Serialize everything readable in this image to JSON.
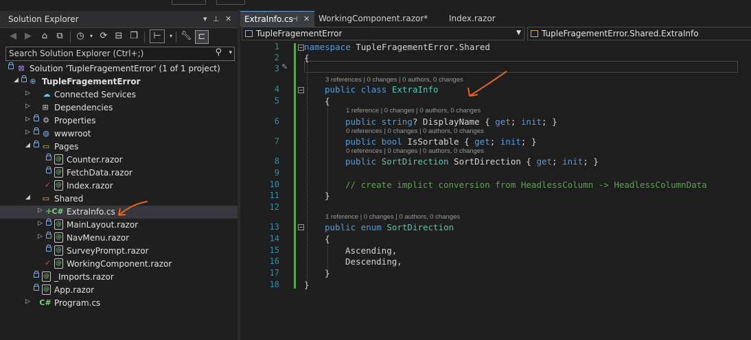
{
  "solution_explorer": {
    "title": "Solution Explorer",
    "search_placeholder": "Search Solution Explorer (Ctrl+;)",
    "tree": [
      {
        "label": "Solution 'TupleFragementError' (1 of 1 project)",
        "icon": "solution-icon"
      },
      {
        "label": "TupleFragementError",
        "icon": "project-icon"
      },
      {
        "label": "Connected Services",
        "icon": "connected-services-icon"
      },
      {
        "label": "Dependencies",
        "icon": "dependencies-icon"
      },
      {
        "label": "Properties",
        "icon": "properties-icon"
      },
      {
        "label": "wwwroot",
        "icon": "globe-icon"
      },
      {
        "label": "Pages",
        "icon": "folder-icon"
      },
      {
        "label": "Counter.razor",
        "icon": "razor-file-icon"
      },
      {
        "label": "FetchData.razor",
        "icon": "razor-file-icon"
      },
      {
        "label": "Index.razor",
        "icon": "razor-file-icon"
      },
      {
        "label": "Shared",
        "icon": "folder-icon"
      },
      {
        "label": "ExtraInfo.cs",
        "icon": "csharp-file-icon"
      },
      {
        "label": "MainLayout.razor",
        "icon": "razor-file-icon"
      },
      {
        "label": "NavMenu.razor",
        "icon": "razor-file-icon"
      },
      {
        "label": "SurveyPrompt.razor",
        "icon": "razor-file-icon"
      },
      {
        "label": "WorkingComponent.razor",
        "icon": "razor-file-icon"
      },
      {
        "label": "_Imports.razor",
        "icon": "razor-file-icon"
      },
      {
        "label": "App.razor",
        "icon": "razor-file-icon"
      },
      {
        "label": "Program.cs",
        "icon": "csharp-file-icon"
      }
    ]
  },
  "editor": {
    "tabs": [
      {
        "label": "ExtraInfo.cs",
        "active": true
      },
      {
        "label": "WorkingComponent.razor*",
        "active": false
      },
      {
        "label": "Index.razor",
        "active": false
      }
    ],
    "nav_project": "TupleFragementError",
    "nav_member": "TupleFragementError.Shared.ExtraInfo",
    "line_numbers": [
      "1",
      "2",
      "3",
      "4",
      "5",
      "6",
      "7",
      "8",
      "9",
      "10",
      "11",
      "12",
      "13",
      "14",
      "15",
      "16",
      "17",
      "18"
    ],
    "code": {
      "l1_kw": "namespace",
      "l1_rest": " TupleFragementError.Shared",
      "l2": "{",
      "lens_class": "3 references | 0 changes | 0 authors, 0 changes",
      "l4_kw": "public class",
      "l4_type": "ExtraInfo",
      "l5": "{",
      "lens_p1": "1 reference | 0 changes | 0 authors, 0 changes",
      "l6_kw1": "public string",
      "l6_mid": "? DisplayName { ",
      "l6_kw2": "get",
      "l6_mid2": "; ",
      "l6_kw3": "init",
      "l6_end": "; }",
      "lens_p2": "0 references | 0 changes | 0 authors, 0 changes",
      "l7_kw1": "public bool",
      "l7_mid": " IsSortable { ",
      "l7_kw2": "get",
      "l7_mid2": "; ",
      "l7_kw3": "init",
      "l7_end": "; }",
      "lens_p3": "0 references | 0 changes | 0 authors, 0 changes",
      "l8_kw1": "public",
      "l8_type": "SortDirection",
      "l8_mid": " SortDirection { ",
      "l8_kw2": "get",
      "l8_mid2": "; ",
      "l8_kw3": "init",
      "l8_end": "; }",
      "l10_comment": "// create implict conversion from HeadlessColumn -> HeadlessColumnData",
      "l11": "}",
      "lens_enum": "1 reference | 0 changes | 0 authors, 0 changes",
      "l13_kw": "public enum",
      "l13_type": "SortDirection",
      "l14": "{",
      "l15": "Ascending,",
      "l16": "Descending,",
      "l17": "}",
      "l18": "}"
    }
  },
  "annotation_color": "#e8651f"
}
